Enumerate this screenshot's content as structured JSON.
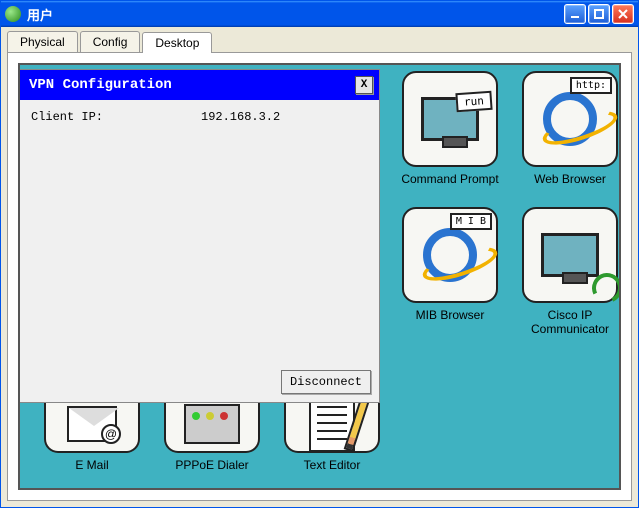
{
  "window": {
    "title": "用户"
  },
  "tabs": {
    "physical": "Physical",
    "config": "Config",
    "desktop": "Desktop"
  },
  "vpn": {
    "title": "VPN Configuration",
    "close_label": "X",
    "client_ip_label": "Client IP:",
    "client_ip_value": "192.168.3.2",
    "disconnect_label": "Disconnect"
  },
  "apps": {
    "command_prompt": {
      "label": "Command Prompt",
      "badge": "run"
    },
    "web_browser": {
      "label": "Web Browser",
      "badge": "http:"
    },
    "mib_browser": {
      "label": "MIB Browser",
      "badge": "M I B"
    },
    "cisco_ipc": {
      "label": "Cisco IP Communicator"
    },
    "email": {
      "label": "E Mail",
      "at": "@"
    },
    "pppoe": {
      "label": "PPPoE Dialer"
    },
    "text_editor": {
      "label": "Text Editor"
    }
  }
}
